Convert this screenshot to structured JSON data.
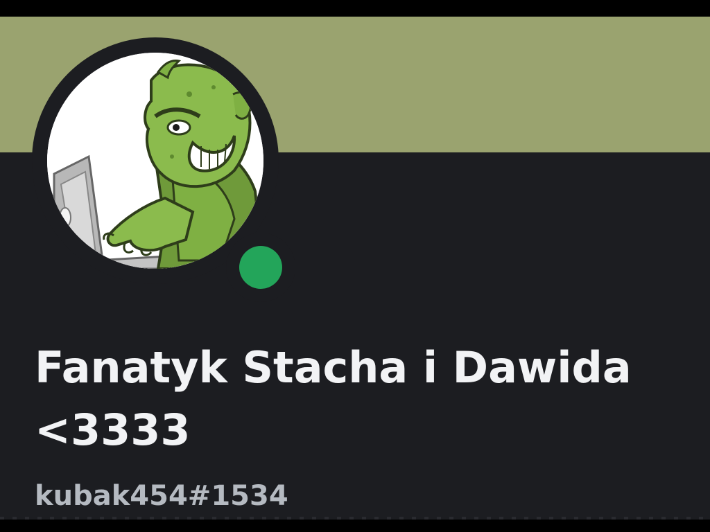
{
  "profile": {
    "display_name": "Fanatyk Stacha i Dawida <3333",
    "username": "kubak454#1534",
    "status": "online"
  },
  "colors": {
    "banner": "#9aa36f",
    "background": "#1c1d21",
    "avatar_ring": "#1c1d21",
    "status_online": "#23a55a",
    "display_name_text": "#f2f3f5",
    "username_text": "#b5bac1"
  },
  "avatar": {
    "icon": "ogre-at-laptop-avatar"
  }
}
